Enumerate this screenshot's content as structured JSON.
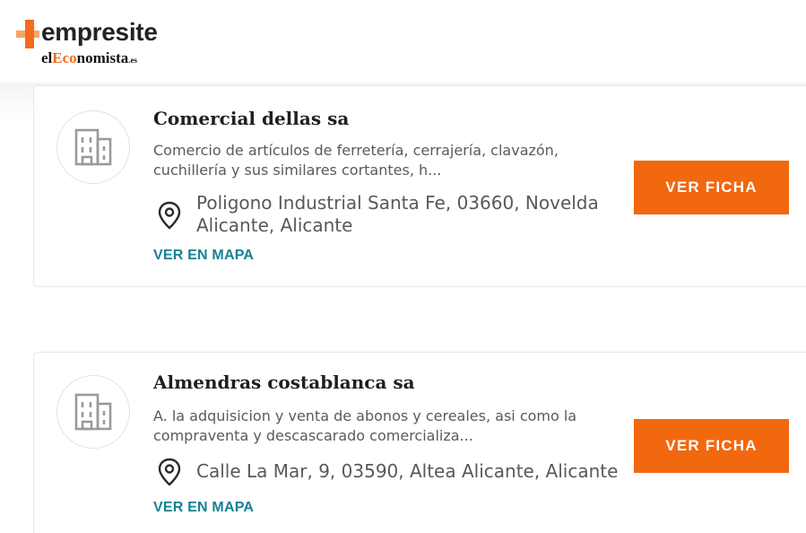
{
  "header": {
    "brand": "empresite",
    "sub_brand_prefix": "el",
    "sub_brand_accent": "Eco",
    "sub_brand_suffix": "nomista",
    "sub_brand_tld": ".es",
    "brand_color": "#f36b1c"
  },
  "results": [
    {
      "name": "Comercial dellas sa",
      "description": "Comercio de artículos de ferretería, cerrajería, clavazón, cuchillería y sus similares cortantes, h...",
      "address": "Poligono Industrial Santa Fe, 03660, Novelda Alicante, Alicante",
      "map_label": "VER EN MAPA",
      "cta_label": "VER FICHA",
      "icon": "building-icon"
    },
    {
      "name": "Almendras costablanca sa",
      "description": "A. la adquisicion y venta de abonos y cereales, asi como la compraventa y descascarado comercializa...",
      "address": "Calle La Mar, 9, 03590, Altea Alicante, Alicante",
      "map_label": "VER EN MAPA",
      "cta_label": "VER FICHA",
      "icon": "building-icon"
    }
  ],
  "colors": {
    "accent": "#f1680f",
    "link": "#178194",
    "text": "#1f1f1f"
  }
}
